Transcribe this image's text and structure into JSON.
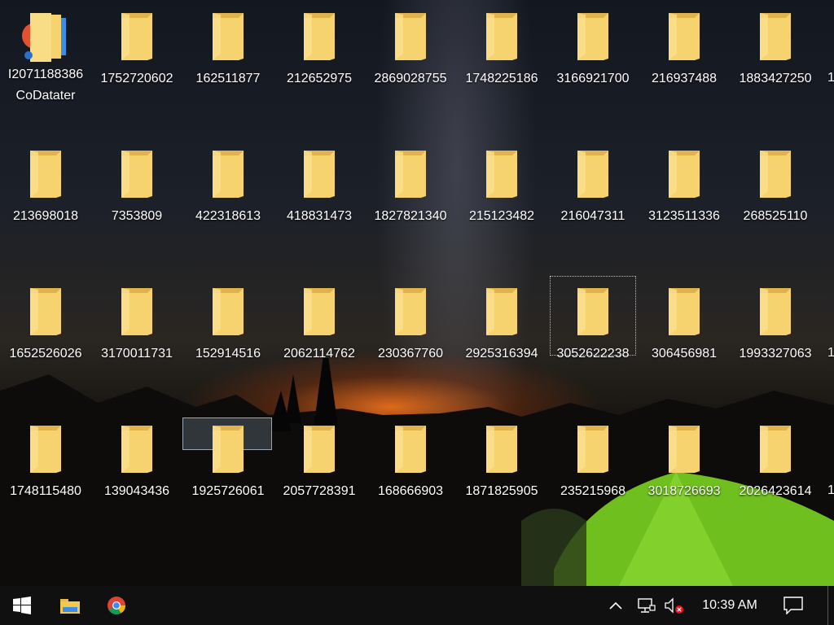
{
  "desktop": {
    "rows": [
      [
        "",
        "1752720602",
        "162511877",
        "212652975",
        "2869028755",
        "1748225186",
        "3166921700",
        "216937488",
        "1883427250"
      ],
      [
        "213698018",
        "7353809",
        "422318613",
        "418831473",
        "1827821340",
        "215123482",
        "216047311",
        "3123511336",
        "268525110"
      ],
      [
        "1652526026",
        "3170011731",
        "152914516",
        "2062114762",
        "230367760",
        "2925316394",
        "3052622238",
        "306456981",
        "1993327063"
      ],
      [
        "1748115480",
        "139043436",
        "1925726061",
        "2057728391",
        "168666903",
        "1871825905",
        "235215968",
        "3018726693",
        "2026423614"
      ]
    ],
    "first_icon": {
      "label_line1": "I2071188386",
      "label_line2": "CoDatater"
    },
    "edge_fragment": "1",
    "focused_icon": "3052622238"
  },
  "taskbar": {
    "start_icon": "windows-logo-icon",
    "pinned": [
      "file-explorer-icon",
      "chrome-icon"
    ],
    "tray_icons": [
      "chevron-up-icon",
      "network-icon",
      "volume-muted-icon"
    ],
    "clock": "10:39 AM",
    "notification_icon": "action-center-icon"
  },
  "colors": {
    "folder_front": "#f6d36f",
    "folder_back": "#e0b44a",
    "taskbar": "#101010",
    "tent": "#7ed321"
  }
}
